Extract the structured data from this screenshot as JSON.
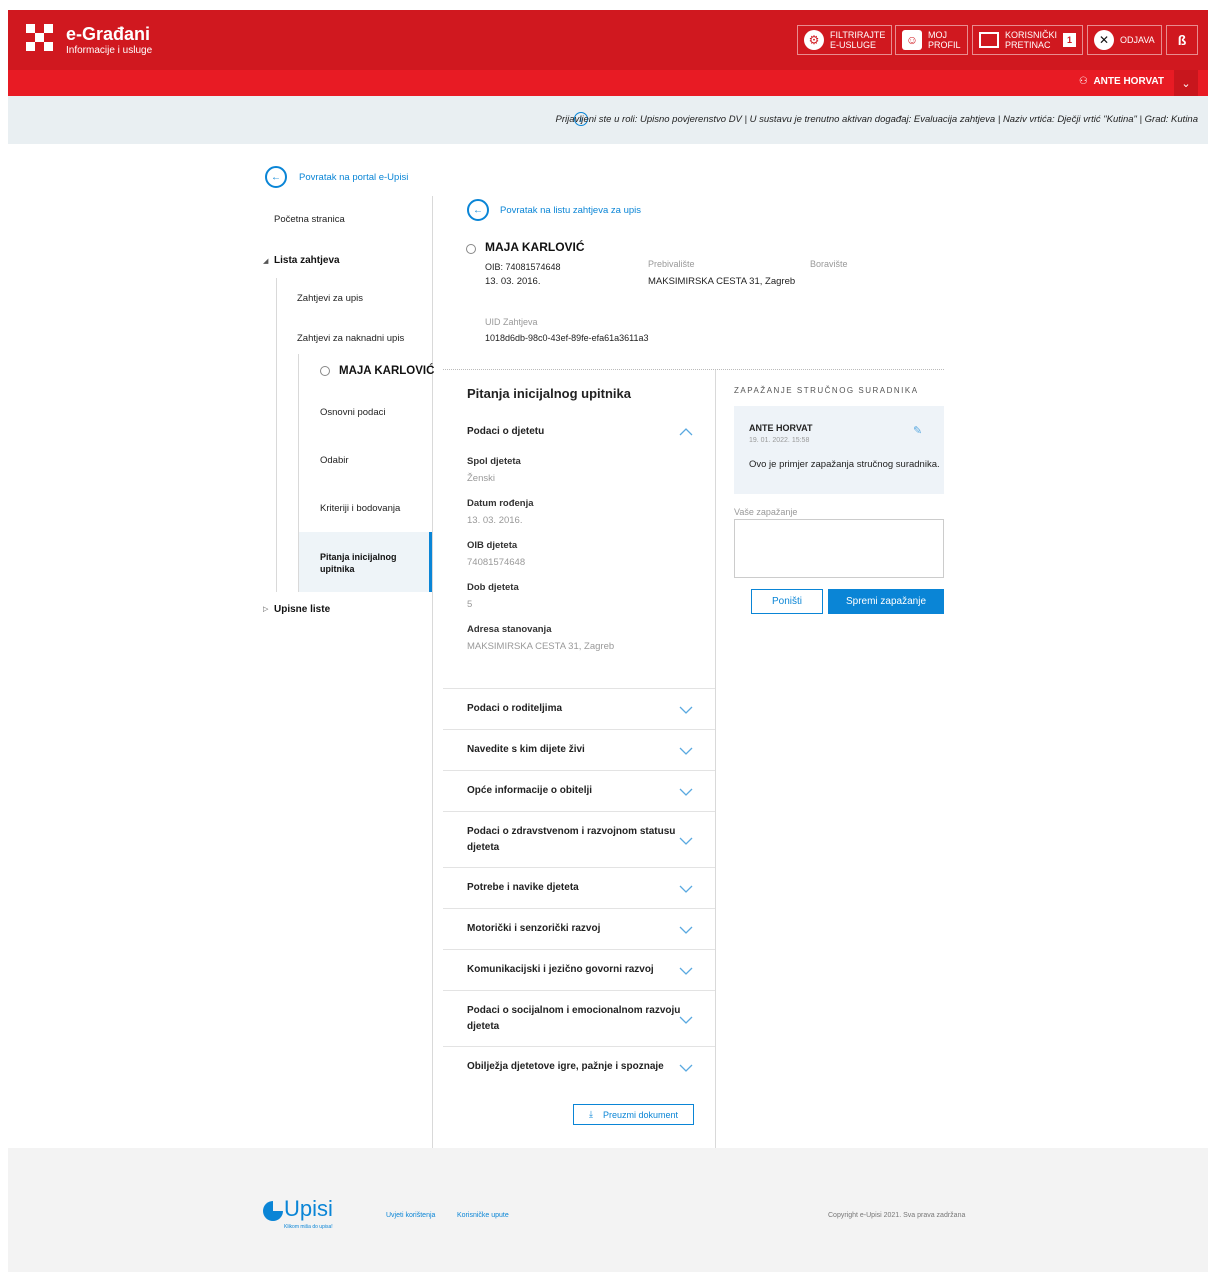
{
  "header": {
    "brand_title": "e-Građani",
    "brand_subtitle": "Informacije i usluge",
    "filter_btn": [
      "FILTRIRAJTE",
      "E-USLUGE"
    ],
    "profile_btn": [
      "MOJ",
      "PROFIL"
    ],
    "inbox_btn": [
      "KORISNIČKI",
      "PRETINAC"
    ],
    "inbox_count": "1",
    "logout_btn": "ODJAVA",
    "lang_btn": "ß",
    "user_name": "ANTE HORVAT"
  },
  "info_bar": {
    "text": "Prijavljeni ste u roli: Upisno povjerenstvo DV | U sustavu je trenutno aktivan događaj: Evaluacija zahtjeva | Naziv vrtića: Dječji vrtić \"Kutina\" | Grad: Kutina"
  },
  "sidebar": {
    "back_link": "Povratak na portal e-Upisi",
    "home": "Početna stranica",
    "list": "Lista zahtjeva",
    "requests": "Zahtjevi za upis",
    "late_requests": "Zahtjevi za naknadni upis",
    "child_name": "MAJA KARLOVIĆ",
    "basic": "Osnovni podaci",
    "choice": "Odabir",
    "criteria": "Kriteriji i bodovanja",
    "questions": [
      "Pitanja inicijalnog",
      "upitnika"
    ],
    "lists": "Upisne liste"
  },
  "main": {
    "back_link": "Povratak na listu zahtjeva za upis",
    "child_name": "MAJA KARLOVIĆ",
    "oib": "OIB: 74081574648",
    "dob": "13. 03. 2016.",
    "residence_label": "Prebivalište",
    "residence_value": "MAKSIMIRSKA CESTA 31, Zagreb",
    "stay_label": "Boravište",
    "uid_label": "UID Zahtjeva",
    "uid_value": "1018d6db-98c0-43ef-89fe-efa61a3611a3",
    "section_title": "Pitanja inicijalnog upitnika",
    "open_section": "Podaci o djetetu",
    "fields": [
      {
        "label": "Spol djeteta",
        "value": "Ženski"
      },
      {
        "label": "Datum rođenja",
        "value": "13. 03. 2016."
      },
      {
        "label": "OIB djeteta",
        "value": "74081574648"
      },
      {
        "label": "Dob djeteta",
        "value": "5"
      },
      {
        "label": "Adresa stanovanja",
        "value": "MAKSIMIRSKA CESTA 31, Zagreb"
      }
    ],
    "accordion": [
      {
        "line1": "Podaci o roditeljima",
        "line2": ""
      },
      {
        "line1": "Navedite s kim dijete živi",
        "line2": ""
      },
      {
        "line1": "Opće informacije o obitelji",
        "line2": ""
      },
      {
        "line1": "Podaci o zdravstvenom i razvojnom statusu",
        "line2": "djeteta"
      },
      {
        "line1": "Potrebe i navike djeteta",
        "line2": ""
      },
      {
        "line1": "Motorički i senzorički razvoj",
        "line2": ""
      },
      {
        "line1": "Komunikacijski i jezično govorni razvoj",
        "line2": ""
      },
      {
        "line1": "Podaci o socijalnom i emocionalnom razvoju",
        "line2": "djeteta"
      },
      {
        "line1": "Obilježja djetetove igre, pažnje i spoznaje",
        "line2": ""
      }
    ],
    "download_btn": "Preuzmi dokument"
  },
  "observation": {
    "title": "ZAPAŽANJE STRUČNOG SURADNIKA",
    "author": "ANTE HORVAT",
    "date": "19. 01. 2022. 15:58",
    "text": "Ovo je primjer zapažanja stručnog suradnika.",
    "your_label": "Vaše zapažanje",
    "cancel_btn": "Poništi",
    "save_btn": "Spremi zapažanje"
  },
  "footer": {
    "logo": "Upisi",
    "logo_tagline": "Klikom miša do upisa!",
    "terms": "Uvjeti korištenja",
    "manual": "Korisničke upute",
    "copyright": "Copyright e-Upisi 2021. Sva prava zadržana"
  },
  "colors": {
    "brand_red": "#d0181f",
    "accent_blue": "#0a85d6"
  }
}
